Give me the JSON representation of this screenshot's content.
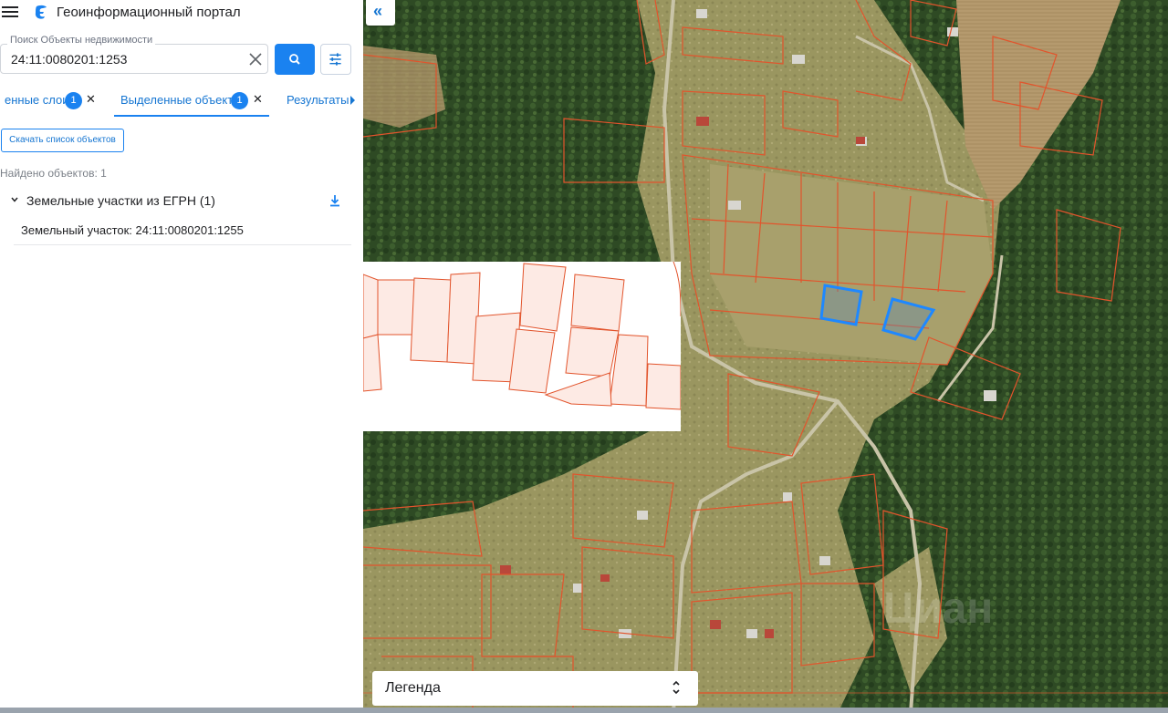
{
  "header": {
    "title": "Геоинформационный портал"
  },
  "search": {
    "label": "Поиск Объекты недвижимости",
    "value": "24:11:0080201:1253"
  },
  "tabs": [
    {
      "label": "енные слои",
      "count": "1"
    },
    {
      "label": "Выделенные объекты",
      "count": "1",
      "active": true
    },
    {
      "label": "Результаты"
    }
  ],
  "actions": {
    "download_list_label": "Скачать список объектов"
  },
  "results": {
    "found_text": "Найдено объектов: 1",
    "group_title": "Земельные участки из ЕГРН (1)",
    "items": [
      {
        "label": "Земельный участок: 24:11:0080201:1255"
      }
    ]
  },
  "legend": {
    "label": "Легенда"
  },
  "colors": {
    "accent": "#1a82f0",
    "parcel_border": "#e2542c",
    "selected_parcel": "#1e88ff"
  },
  "icons": {
    "menu": "menu-icon",
    "logo": "portal-logo-icon",
    "clear": "close-icon",
    "search": "search-icon",
    "filter": "sliders-icon",
    "download": "download-icon",
    "collapse": "double-chevron-left-icon",
    "legend_toggle": "unfold-icon"
  },
  "watermark": "Циан"
}
